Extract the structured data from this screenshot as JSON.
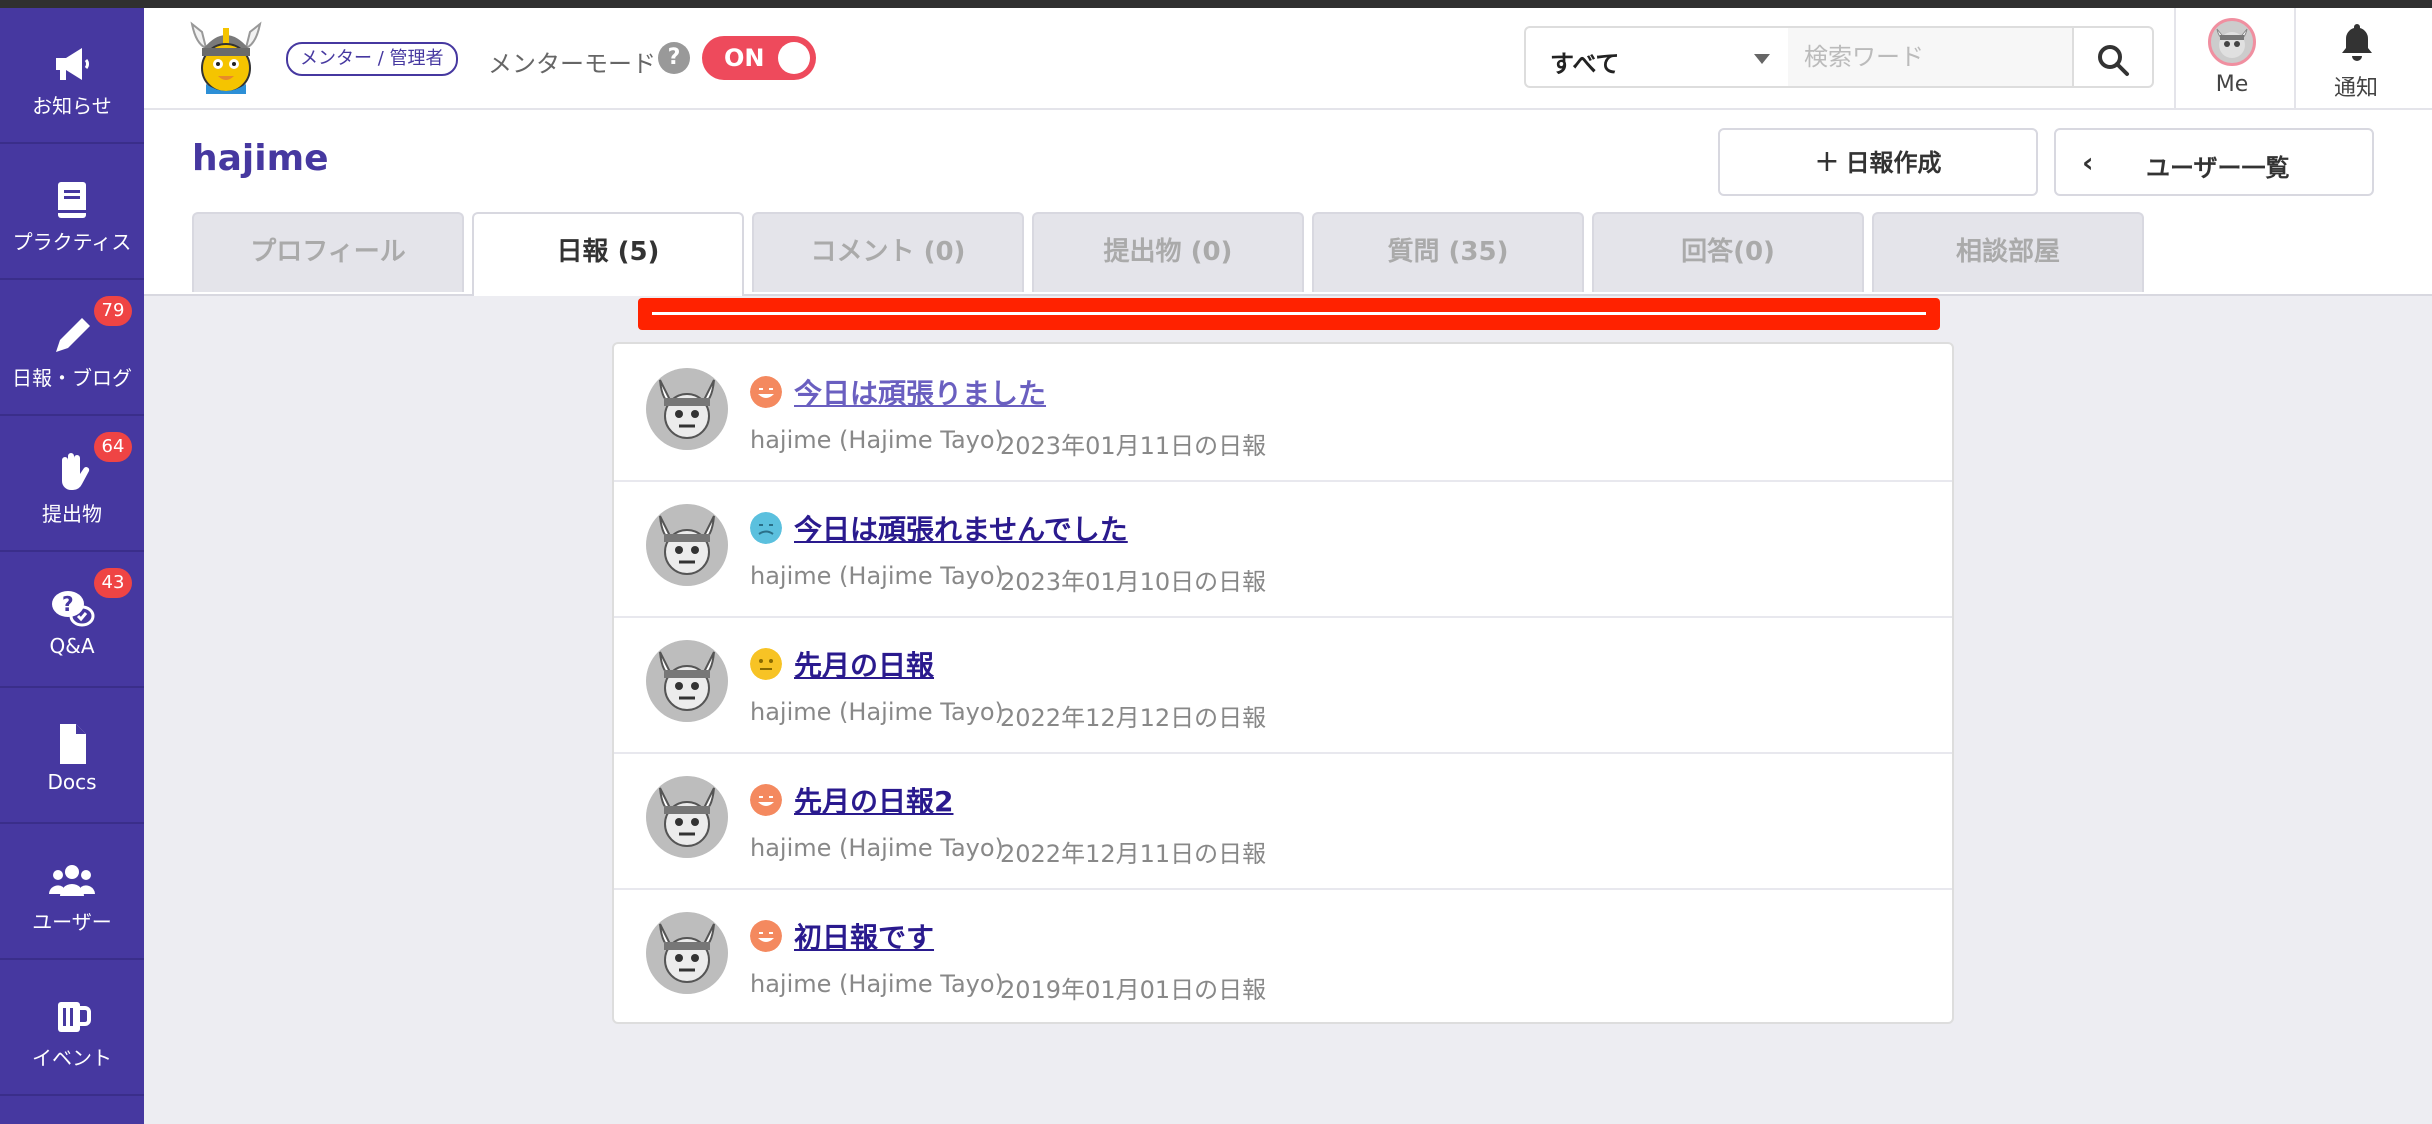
{
  "sidebar": {
    "items": [
      {
        "label": "お知らせ",
        "icon": "megaphone-icon",
        "badge": ""
      },
      {
        "label": "プラクティス",
        "icon": "book-icon",
        "badge": ""
      },
      {
        "label": "日報・ブログ",
        "icon": "pencil-icon",
        "badge": "79"
      },
      {
        "label": "提出物",
        "icon": "hand-icon",
        "badge": "64"
      },
      {
        "label": "Q&A",
        "icon": "qa-icon",
        "badge": "43"
      },
      {
        "label": "Docs",
        "icon": "document-icon",
        "badge": ""
      },
      {
        "label": "ユーザー",
        "icon": "users-icon",
        "badge": ""
      },
      {
        "label": "イベント",
        "icon": "beer-mug-icon",
        "badge": ""
      }
    ]
  },
  "header": {
    "role_badge": "メンター / 管理者",
    "mentor_mode_label": "メンターモード",
    "help_icon_glyph": "?",
    "toggle_label": "ON",
    "search_scope": "すべて",
    "search_placeholder": "検索ワード",
    "me_label": "Me",
    "notification_label": "通知"
  },
  "page": {
    "title": "hajime",
    "new_report_label": "日報作成",
    "user_list_label": "ユーザー一覧",
    "tabs": [
      {
        "label": "プロフィール",
        "active": false
      },
      {
        "label": "日報 (5)",
        "active": true
      },
      {
        "label": "コメント (0)",
        "active": false
      },
      {
        "label": "提出物 (0)",
        "active": false
      },
      {
        "label": "質問 (35)",
        "active": false
      },
      {
        "label": "回答(0)",
        "active": false
      },
      {
        "label": "相談部屋",
        "active": false
      }
    ]
  },
  "reports": [
    {
      "title": "今日は頑張りました",
      "author": "hajime (Hajime Tayo)",
      "date": "2023年01月11日の日報",
      "emotion": "happy",
      "emotion_color": "#f4895f",
      "visited": true
    },
    {
      "title": "今日は頑張れませんでした",
      "author": "hajime (Hajime Tayo)",
      "date": "2023年01月10日の日報",
      "emotion": "sad",
      "emotion_color": "#5bc0de",
      "visited": false
    },
    {
      "title": "先月の日報",
      "author": "hajime (Hajime Tayo)",
      "date": "2022年12月12日の日報",
      "emotion": "neutral",
      "emotion_color": "#f7c325",
      "visited": false
    },
    {
      "title": "先月の日報2",
      "author": "hajime (Hajime Tayo)",
      "date": "2022年12月11日の日報",
      "emotion": "happy",
      "emotion_color": "#f4895f",
      "visited": false
    },
    {
      "title": "初日報です",
      "author": "hajime (Hajime Tayo)",
      "date": "2019年01月01日の日報",
      "emotion": "happy",
      "emotion_color": "#f4895f",
      "visited": false
    }
  ],
  "colors": {
    "brand": "#4638a0",
    "toggle_on": "#ee4a5c",
    "badge": "#ef4444",
    "alert_bar": "#ff2200"
  }
}
